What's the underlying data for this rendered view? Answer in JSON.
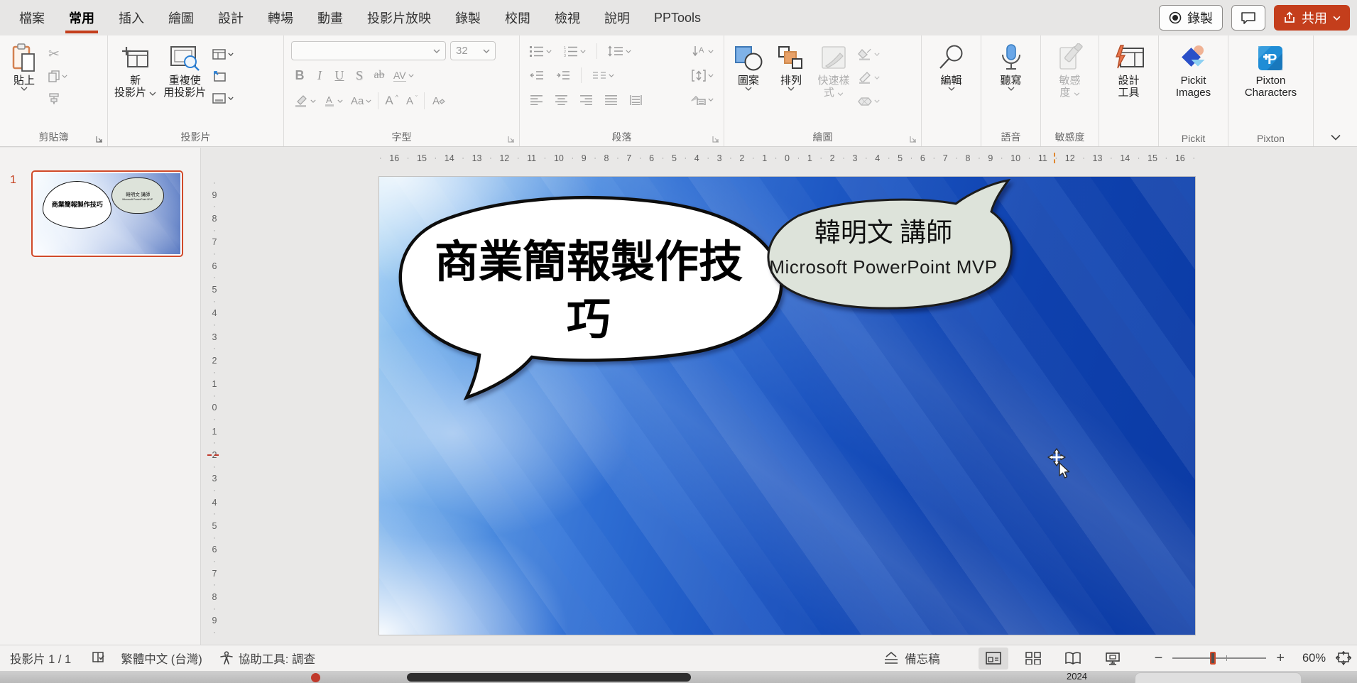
{
  "menubar": {
    "tabs": [
      {
        "label": "檔案",
        "active": false
      },
      {
        "label": "常用",
        "active": true
      },
      {
        "label": "插入",
        "active": false
      },
      {
        "label": "繪圖",
        "active": false
      },
      {
        "label": "設計",
        "active": false
      },
      {
        "label": "轉場",
        "active": false
      },
      {
        "label": "動畫",
        "active": false
      },
      {
        "label": "投影片放映",
        "active": false
      },
      {
        "label": "錄製",
        "active": false
      },
      {
        "label": "校閱",
        "active": false
      },
      {
        "label": "檢視",
        "active": false
      },
      {
        "label": "說明",
        "active": false
      },
      {
        "label": "PPTools",
        "active": false
      }
    ],
    "record_button": "錄製",
    "share_button": "共用"
  },
  "ribbon": {
    "clipboard": {
      "label": "剪貼簿",
      "paste": "貼上"
    },
    "slides": {
      "label": "投影片",
      "new_slide_lines": [
        "新",
        "投影片"
      ],
      "reuse_lines": [
        "重複使",
        "用投影片"
      ]
    },
    "font": {
      "label": "字型",
      "name_value": "",
      "size_value": "32",
      "bold": "B",
      "italic": "I",
      "underline": "U",
      "shadow": "S",
      "strike": "ab",
      "spacing": "AV",
      "case_btn": "Aa",
      "grow": "A",
      "shrink": "A",
      "clear": "A"
    },
    "paragraph": {
      "label": "段落"
    },
    "drawing": {
      "label": "繪圖",
      "shapes": "圖案",
      "arrange": "排列",
      "quick_styles_lines": [
        "快速樣",
        "式"
      ]
    },
    "editing": {
      "button": "編輯"
    },
    "voice": {
      "label": "語音",
      "dictate": "聽寫"
    },
    "sensitivity": {
      "label": "敏感度",
      "button_lines": [
        "敏感",
        "度"
      ]
    },
    "designer": {
      "button_lines": [
        "設計",
        "工具"
      ]
    },
    "pickit": {
      "label": "Pickit",
      "button_lines": [
        "Pickit",
        "Images"
      ]
    },
    "pixton": {
      "label": "Pixton",
      "button_lines": [
        "Pixton",
        "Characters"
      ]
    }
  },
  "slide_panel": {
    "slide_number": "1"
  },
  "rulers": {
    "horizontal": [
      16,
      15,
      14,
      13,
      12,
      11,
      10,
      9,
      8,
      7,
      6,
      5,
      4,
      3,
      2,
      1,
      0,
      1,
      2,
      3,
      4,
      5,
      6,
      7,
      8,
      9,
      10,
      11,
      12,
      13,
      14,
      15,
      16
    ],
    "vertical": [
      9,
      8,
      7,
      6,
      5,
      4,
      3,
      2,
      1,
      0,
      1,
      2,
      3,
      4,
      5,
      6,
      7,
      8,
      9
    ]
  },
  "slide": {
    "title": "商業簡報製作技巧",
    "speaker_name": "韓明文 講師",
    "speaker_credential": "Microsoft PowerPoint MVP"
  },
  "statusbar": {
    "slide_indicator": "投影片 1 / 1",
    "language": "繁體中文 (台灣)",
    "accessibility": "協助工具: 調查",
    "notes": "備忘稿",
    "zoom_level": "60%"
  },
  "taskbar": {
    "date": "2024"
  },
  "colors": {
    "accent": "#C43E1C",
    "slide_blue": "#0B3AA4",
    "bubble_green": "#DDE3DA"
  }
}
